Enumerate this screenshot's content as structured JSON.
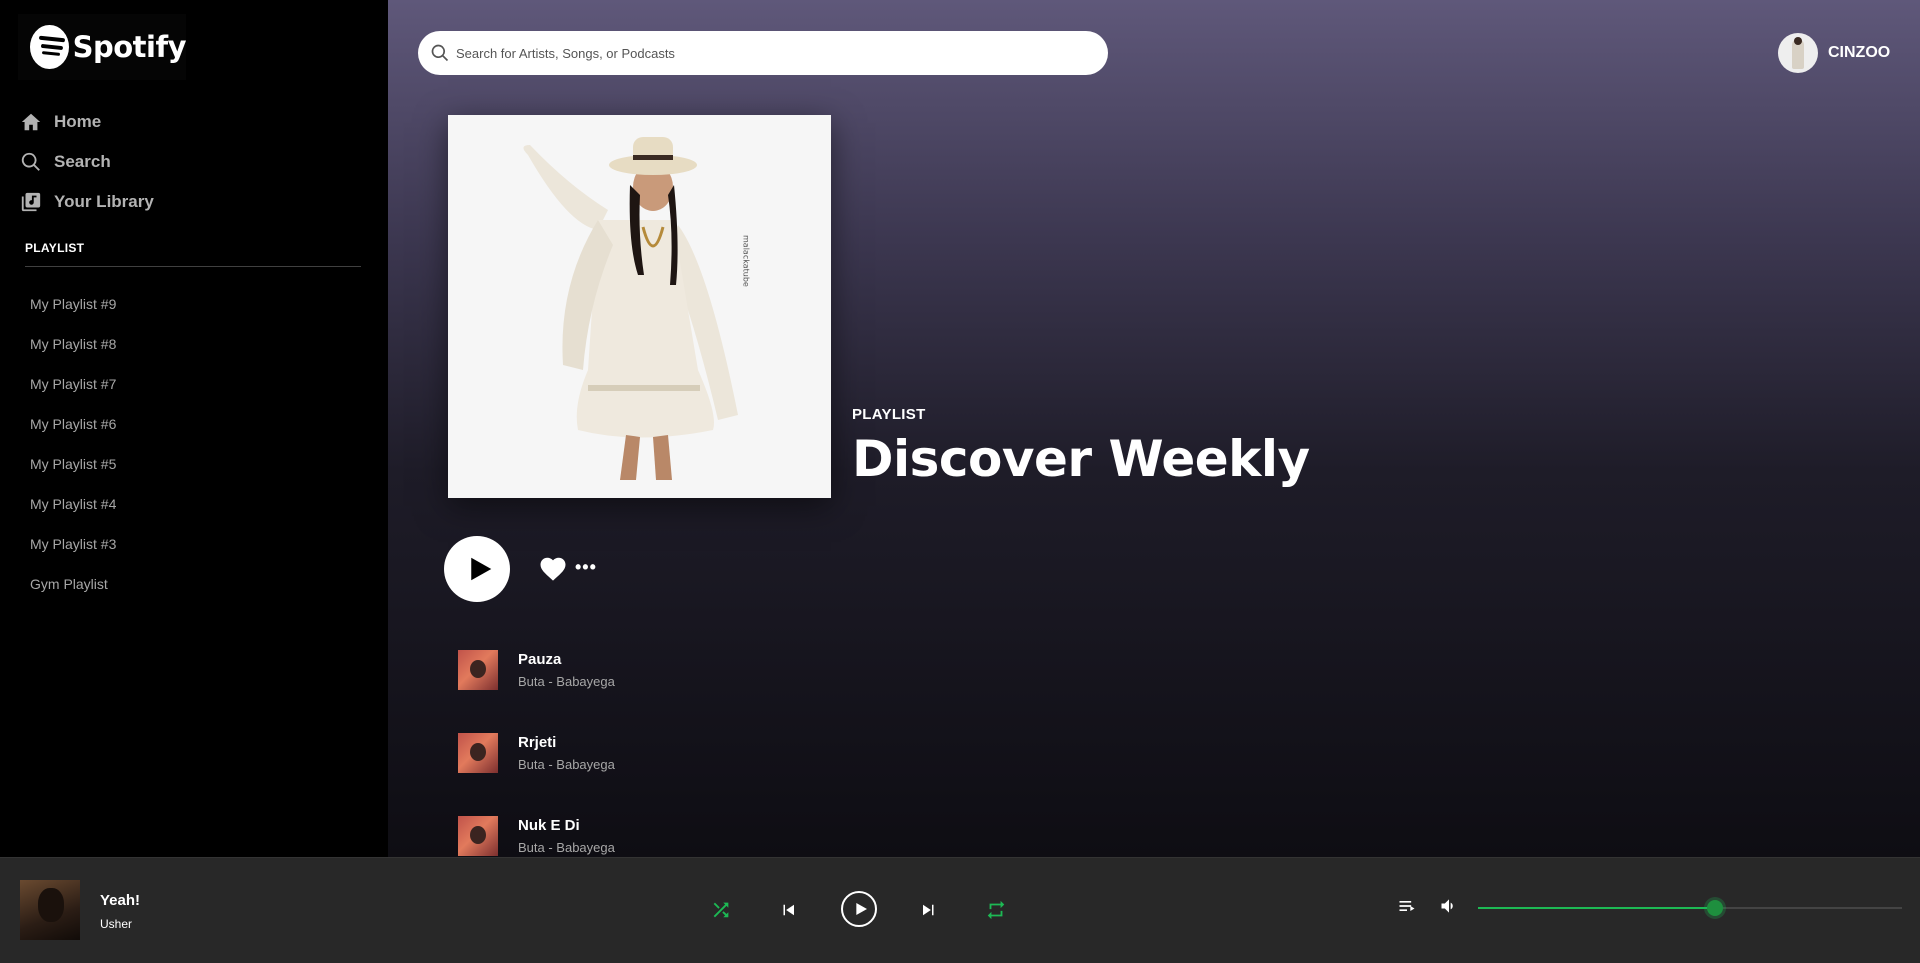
{
  "brand": {
    "name": "Spotify"
  },
  "sidebar": {
    "nav": [
      {
        "label": "Home",
        "icon": "home-icon"
      },
      {
        "label": "Search",
        "icon": "search-icon"
      },
      {
        "label": "Your Library",
        "icon": "library-icon"
      }
    ],
    "playlist_heading": "PLAYLIST",
    "playlists": [
      "My Playlist #9",
      "My Playlist #8",
      "My Playlist #7",
      "My Playlist #6",
      "My Playlist #5",
      "My Playlist #4",
      "My Playlist #3",
      "Gym Playlist"
    ]
  },
  "header": {
    "search_placeholder": "Search for Artists, Songs, or Podcasts",
    "username": "CINZOO"
  },
  "playlist": {
    "type": "PLAYLIST",
    "title": "Discover Weekly",
    "tracks": [
      {
        "name": "Pauza",
        "artist": "Buta - Babayega"
      },
      {
        "name": "Rrjeti",
        "artist": "Buta - Babayega"
      },
      {
        "name": "Nuk E Di",
        "artist": "Buta - Babayega"
      }
    ]
  },
  "player": {
    "now_playing": {
      "title": "Yeah!",
      "artist": "Usher"
    },
    "volume_fraction": 0.56
  },
  "colors": {
    "accent": "#1db954",
    "sidebar_bg": "#000000",
    "player_bg": "#282828"
  }
}
